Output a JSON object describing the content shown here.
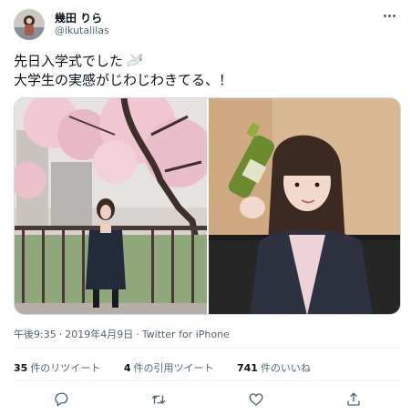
{
  "user": {
    "display_name": "幾田 りら",
    "handle": "@ikutalilas"
  },
  "tweet": {
    "line1": "先日入学式でした",
    "line2": "大学生の実感がじわじわきてる、！",
    "emoji_icon": "dove-icon"
  },
  "media": {
    "count": 2,
    "left_photo": "cherry-blossom-entrance-photo",
    "right_photo": "green-tea-bottle-photo"
  },
  "meta": {
    "time": "午後9:35",
    "separator": "·",
    "date": "2019年4月9日",
    "source": "Twitter for iPhone"
  },
  "stats": {
    "retweets_count": "35",
    "retweets_label": "件のリツイート",
    "quotes_count": "4",
    "quotes_label": "件の引用ツイート",
    "likes_count": "741",
    "likes_label": "件のいいね"
  },
  "actions": [
    "reply-icon",
    "retweet-icon",
    "like-icon",
    "share-icon"
  ],
  "colors": {
    "text_primary": "#0f1419",
    "text_secondary": "#536471",
    "divider": "#eff3f4",
    "border": "#cfd9de"
  }
}
